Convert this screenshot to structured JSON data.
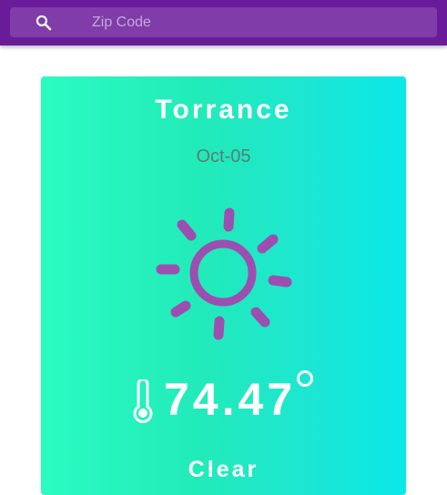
{
  "search": {
    "placeholder": "Zip Code",
    "value": "",
    "icon": "search-icon"
  },
  "weather": {
    "city": "Torrance",
    "date": "Oct-05",
    "condition_icon": "sun-icon",
    "temperature": "74.47",
    "temperature_icon": "thermometer-icon",
    "unit_icon": "degree-icon",
    "condition": "Clear"
  },
  "colors": {
    "appbar": "#6a1b9a",
    "card_gradient_start": "#2afcc0",
    "card_gradient_end": "#0ae8ea",
    "sun": "#9c4fb0",
    "text": "#ffffff",
    "date": "#5a7d77"
  }
}
